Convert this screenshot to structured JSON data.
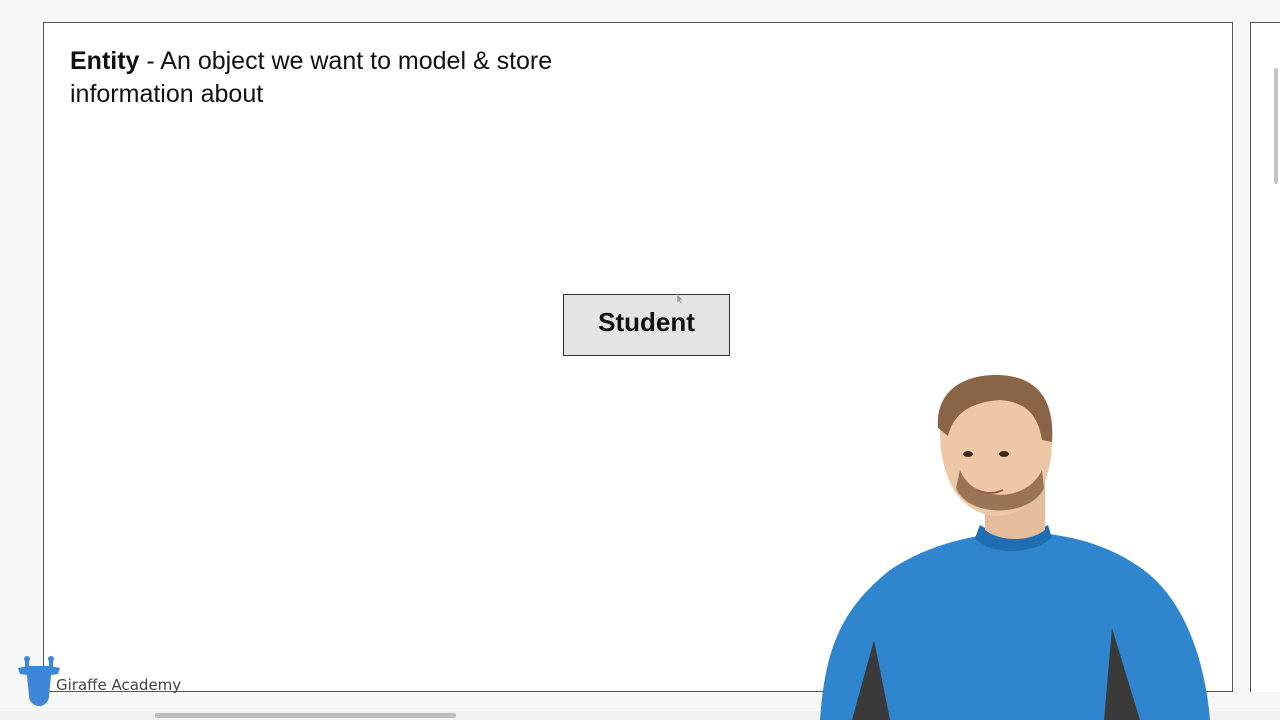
{
  "slide": {
    "heading_term": "Entity",
    "heading_definition": " - An object we want to model & store information about",
    "entity_label": "Student"
  },
  "branding": {
    "name": "Giraffe Academy",
    "logo_icon": "giraffe-logo-icon",
    "logo_color": "#3d86d8"
  },
  "colors": {
    "entity_fill": "#e4e4e4",
    "presenter_shirt": "#2f86cf"
  }
}
